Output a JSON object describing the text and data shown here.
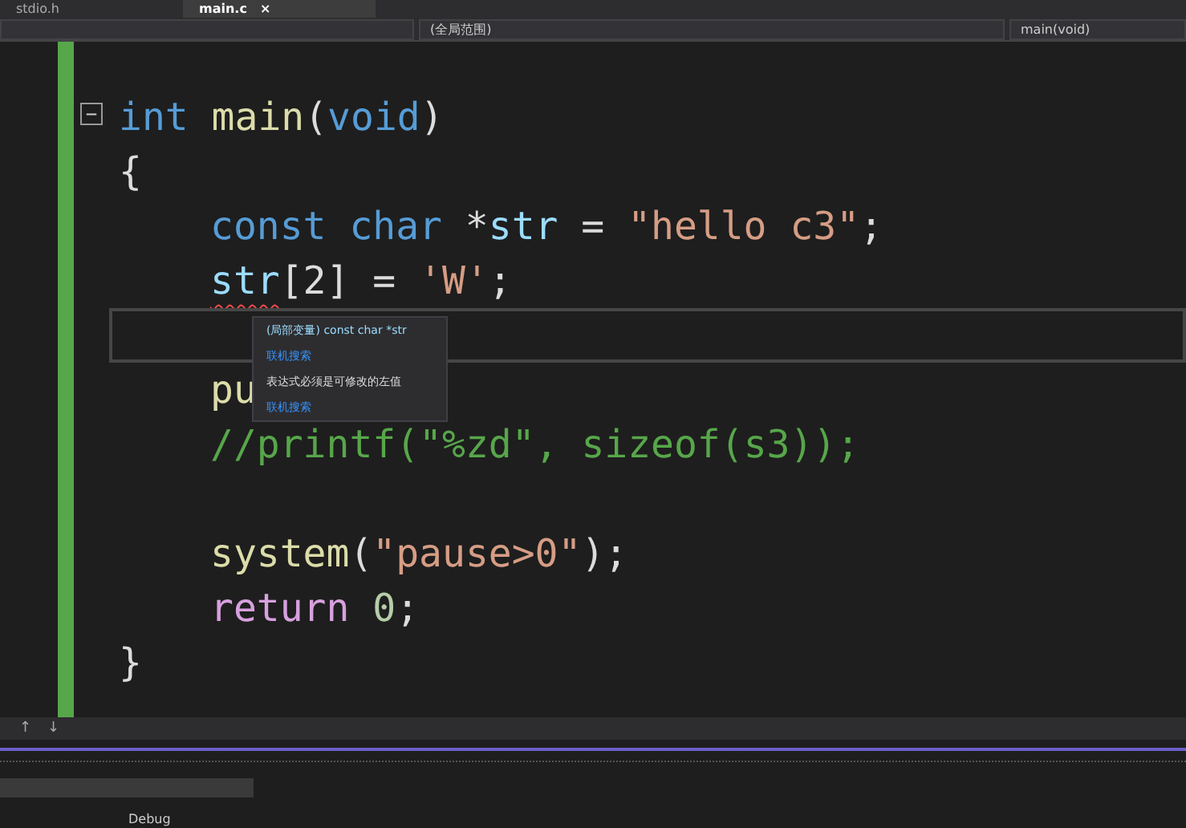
{
  "tabs": [
    {
      "label": "stdio.h",
      "selected": false
    },
    {
      "label": "main.c",
      "selected": true,
      "close": "×"
    }
  ],
  "nav_bar": {
    "scope": "(全局范围)",
    "member": "main(void)"
  },
  "code_lines": [
    {
      "fold": "−",
      "tokens": [
        {
          "text": "int",
          "kind": "keyword"
        },
        {
          "text": "main",
          "kind": "function",
          "space_before": true
        },
        {
          "text": "(",
          "kind": "plain"
        },
        {
          "text": "void",
          "kind": "keyword"
        },
        {
          "text": ")",
          "kind": "plain"
        }
      ]
    },
    {
      "tokens": [
        {
          "text": "{",
          "kind": "plain"
        }
      ]
    },
    {
      "indented": true,
      "tokens": [
        {
          "text": "const",
          "kind": "keyword"
        },
        {
          "text": "char",
          "kind": "keyword",
          "space_before": true
        },
        {
          "text": "*",
          "kind": "plain",
          "space_before": true
        },
        {
          "text": "str",
          "kind": "variable"
        },
        {
          "text": "=",
          "kind": "plain",
          "space_before": true
        },
        {
          "text": "\"hello c3\"",
          "kind": "string",
          "space_before": true
        },
        {
          "text": ";",
          "kind": "plain"
        }
      ]
    },
    {
      "indented": true,
      "tokens": [
        {
          "text": "str",
          "kind": "variable",
          "error": true
        },
        {
          "text": "[2]",
          "kind": "plain"
        },
        {
          "text": "=",
          "kind": "plain",
          "space_before": true
        },
        {
          "text": "'W'",
          "kind": "string",
          "space_before": true
        },
        {
          "text": ";",
          "kind": "plain"
        }
      ]
    },
    {
      "current": true
    },
    {
      "indented": true,
      "tokens": [
        {
          "text": "pu",
          "kind": "function"
        }
      ]
    },
    {
      "indented": true,
      "blank_line_after": true,
      "tokens": [
        {
          "text": "//printf(\"%zd\", sizeof(s3));",
          "kind": "comment"
        }
      ]
    },
    {
      "indented": true,
      "tokens": [
        {
          "text": "system",
          "kind": "function"
        },
        {
          "text": "(",
          "kind": "plain"
        },
        {
          "text": "\"pause>0\"",
          "kind": "string"
        },
        {
          "text": ");",
          "kind": "plain"
        }
      ]
    },
    {
      "indented": true,
      "tokens": [
        {
          "text": "return",
          "kind": "control"
        },
        {
          "text": "0",
          "kind": "number",
          "space_before": true
        },
        {
          "text": ";",
          "kind": "plain"
        }
      ]
    },
    {
      "tokens": [
        {
          "text": "}",
          "kind": "plain"
        }
      ]
    }
  ],
  "tooltip": {
    "signature_prefix": "(局部变量)",
    "signature": "const char *str",
    "links": [
      "联机搜索"
    ],
    "message": "表达式必须是可修改的左值",
    "footer_link": "联机搜索"
  },
  "scroll_arrows": [
    "↑",
    "↓"
  ],
  "status_bar": {
    "configuration": "Debug"
  }
}
